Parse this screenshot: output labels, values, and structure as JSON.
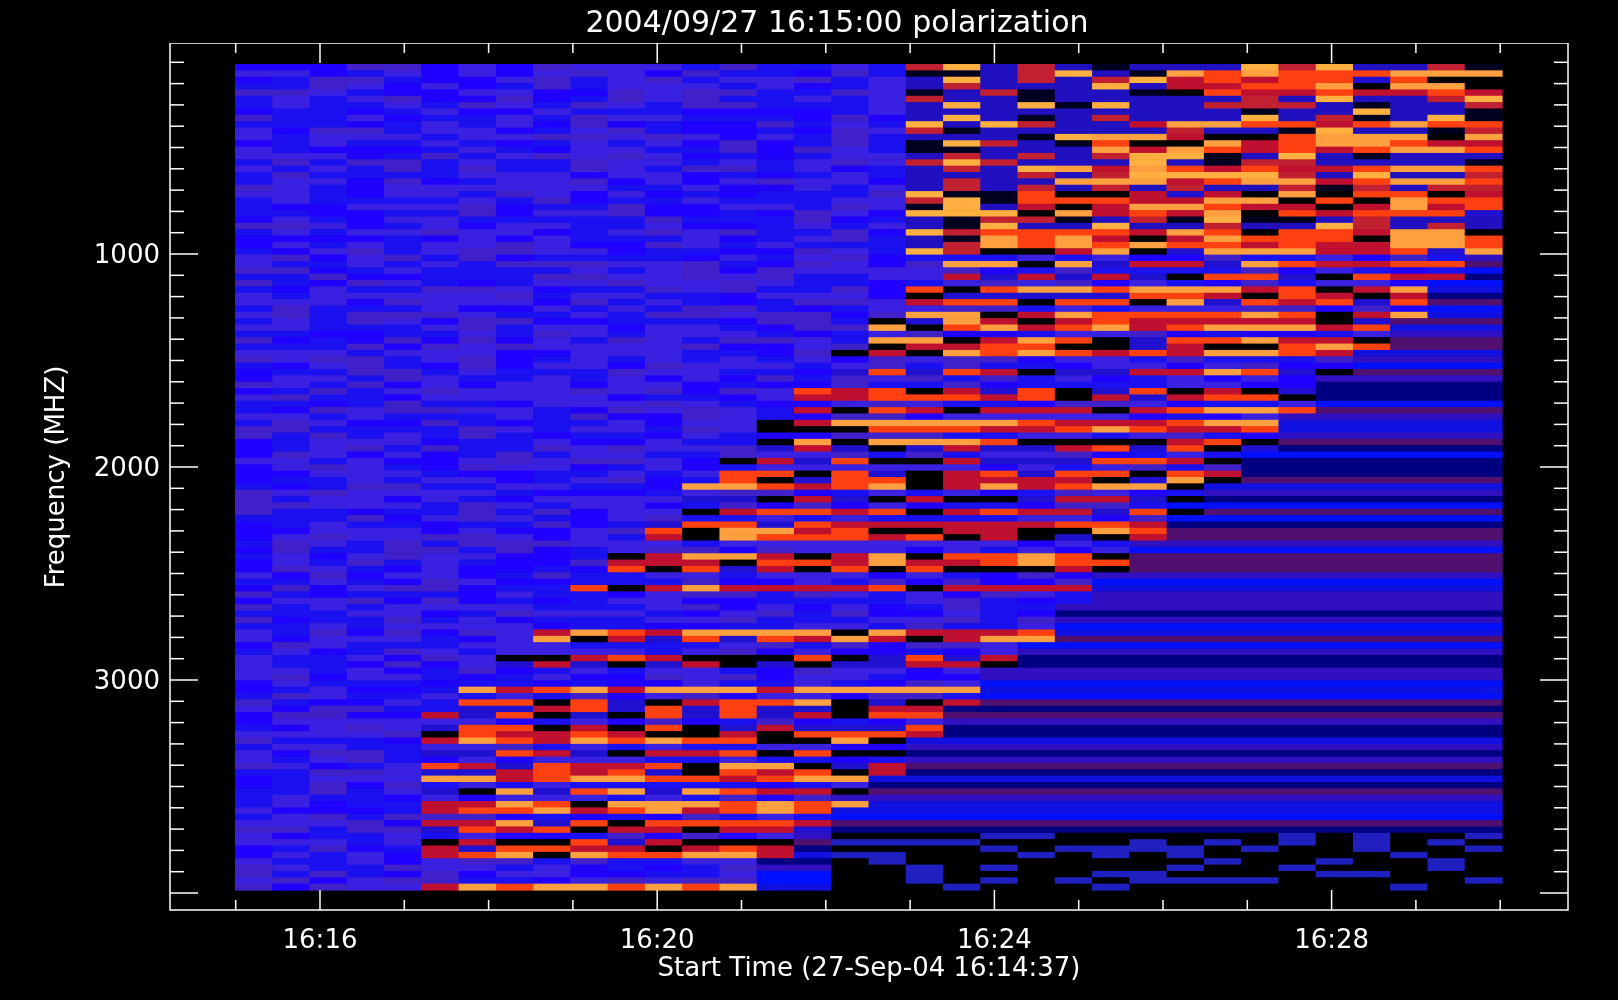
{
  "title": "2004/09/27 16:15:00 polarization",
  "plot": {
    "xlabel": "Start Time (27-Sep-04 16:14:37)",
    "ylabel": "Frequency (MHZ)",
    "xticks": [
      "16:16",
      "16:20",
      "16:24",
      "16:28"
    ],
    "yticks": [
      "1000",
      "2000",
      "3000"
    ]
  }
}
